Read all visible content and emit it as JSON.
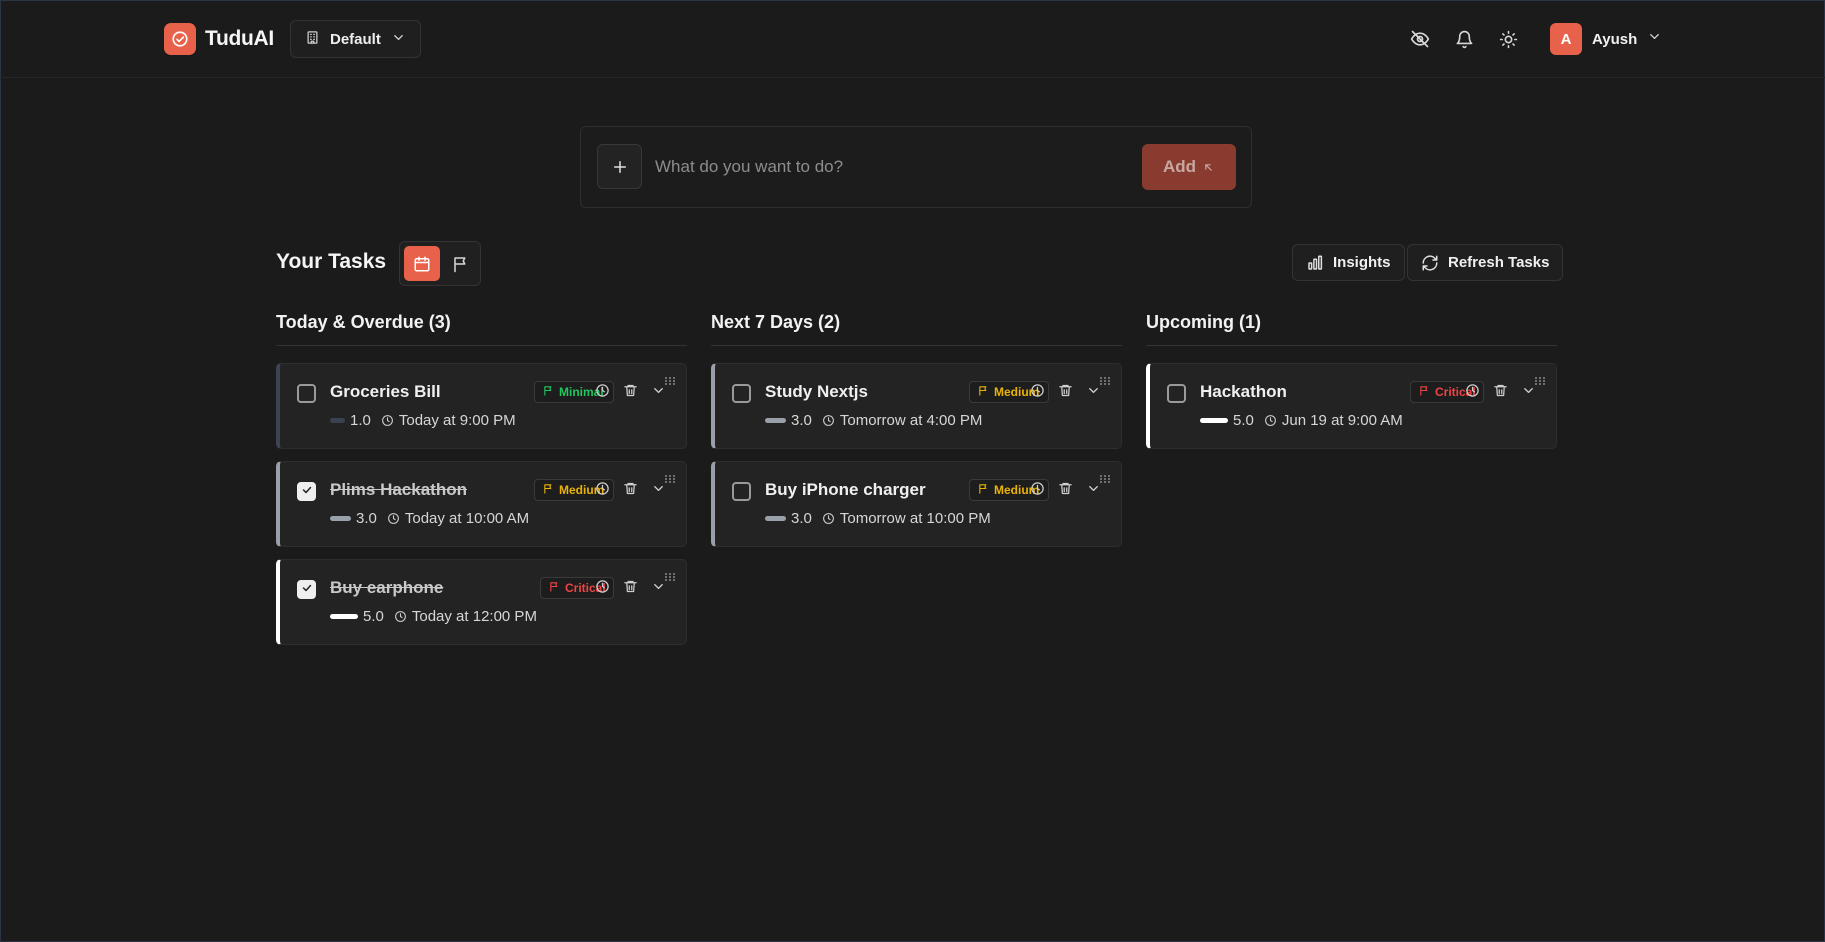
{
  "app": {
    "name": "TuduAI"
  },
  "workspace": {
    "selected": "Default"
  },
  "user": {
    "initial": "A",
    "name": "Ayush"
  },
  "add_task": {
    "placeholder": "What do you want to do?",
    "add_label": "Add"
  },
  "tasks_header": {
    "title": "Your Tasks",
    "insights_label": "Insights",
    "refresh_label": "Refresh Tasks"
  },
  "colors": {
    "accent": "#e8624b",
    "minimal": "#22c55e",
    "medium": "#eab308",
    "critical": "#ef4444"
  },
  "columns": [
    {
      "title": "Today & Overdue (3)",
      "cards": [
        {
          "title": "Groceries Bill",
          "done": false,
          "priority": "Minimal",
          "score": "1.0",
          "score_fill": 0.2,
          "due": "Today at 9:00 PM"
        },
        {
          "title": "Plims Hackathon",
          "done": true,
          "priority": "Medium",
          "score": "3.0",
          "score_fill": 0.6,
          "due": "Today at 10:00 AM"
        },
        {
          "title": "Buy earphone",
          "done": true,
          "priority": "Critical",
          "score": "5.0",
          "score_fill": 1.0,
          "due": "Today at 12:00 PM"
        }
      ]
    },
    {
      "title": "Next 7 Days (2)",
      "cards": [
        {
          "title": "Study Nextjs",
          "done": false,
          "priority": "Medium",
          "score": "3.0",
          "score_fill": 0.6,
          "due": "Tomorrow at 4:00 PM"
        },
        {
          "title": "Buy iPhone charger",
          "done": false,
          "priority": "Medium",
          "score": "3.0",
          "score_fill": 0.6,
          "due": "Tomorrow at 10:00 PM"
        }
      ]
    },
    {
      "title": "Upcoming (1)",
      "cards": [
        {
          "title": "Hackathon",
          "done": false,
          "priority": "Critical",
          "score": "5.0",
          "score_fill": 1.0,
          "due": "Jun 19 at 9:00 AM"
        }
      ]
    }
  ]
}
